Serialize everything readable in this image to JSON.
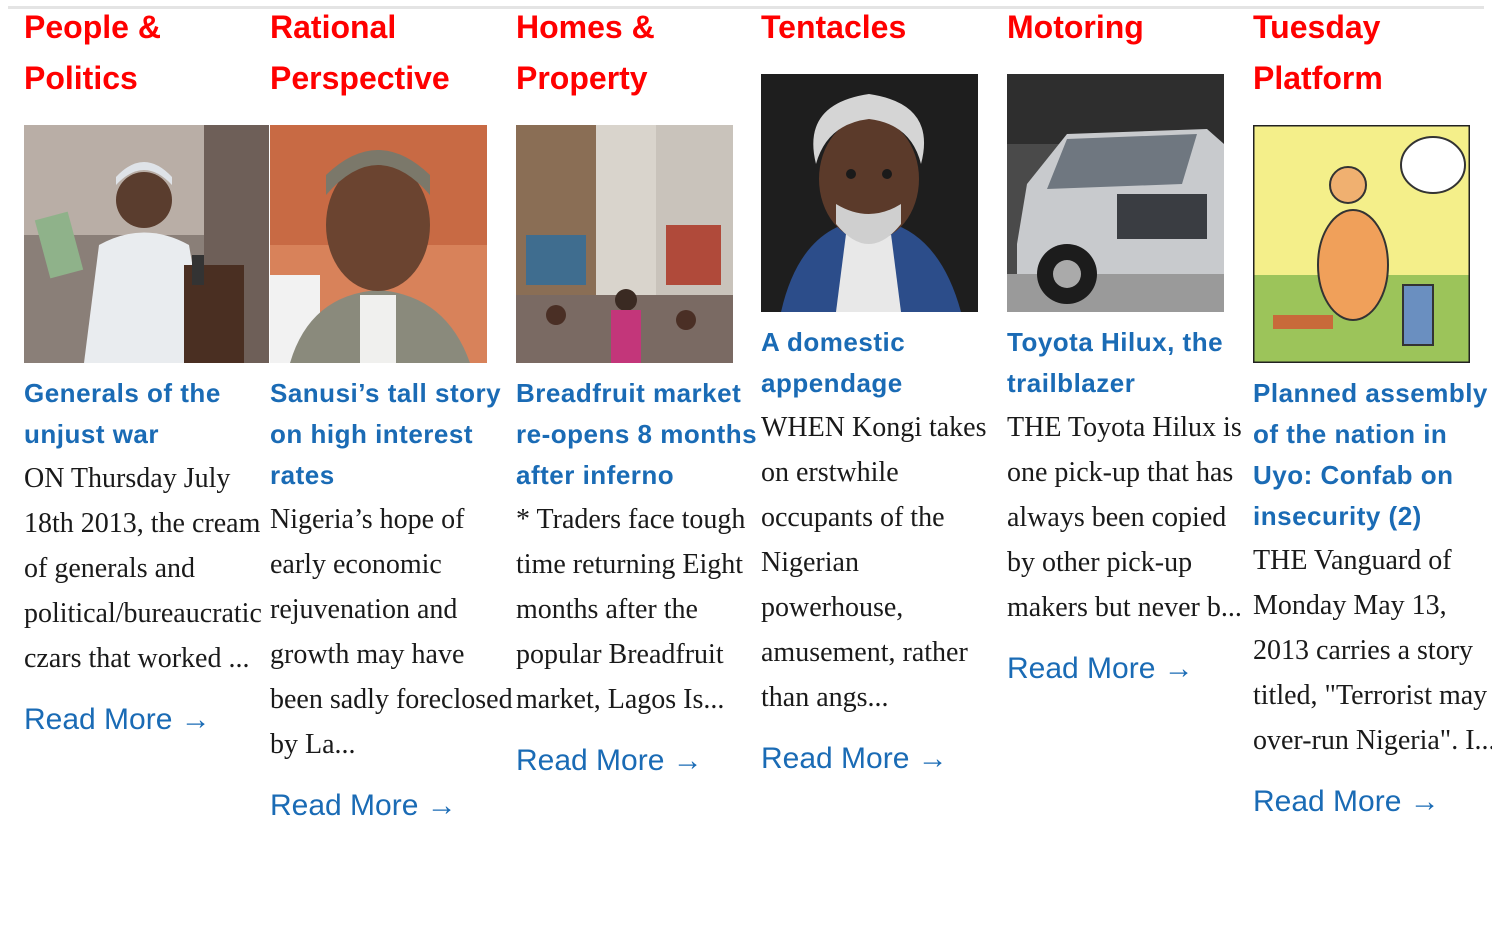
{
  "colors": {
    "category": "#ff0000",
    "link": "#1a6bb5",
    "text": "#1a1a1a"
  },
  "columns": [
    {
      "category": "People & Politics",
      "image_subject": "man-with-money-at-podium",
      "title": "Generals of the unjust war",
      "excerpt": "ON Thursday July 18th 2013, the cream of generals and political/bureaucratic czars that worked ...",
      "read_more": "Read More →"
    },
    {
      "category": "Rational Perspective",
      "image_subject": "man-in-grey-cap-portrait",
      "title": "Sanusi’s tall story on high interest rates",
      "excerpt": "Nigeria’s hope of early economic rejuvenation and growth may have been sadly foreclosed by La...",
      "read_more": "Read More →"
    },
    {
      "category": "Homes & Property",
      "image_subject": "crowded-market-street",
      "title": "Breadfruit market re-opens 8 months after inferno",
      "excerpt": "* Traders face tough time returning Eight months after the popular Breadfruit market, Lagos Is...",
      "read_more": "Read More →"
    },
    {
      "category": "Tentacles",
      "image_subject": "grey-haired-man-portrait",
      "title": "A domestic appendage",
      "excerpt": "WHEN Kongi takes on erstwhile occupants of the Nigerian powerhouse, amusement, rather than angs...",
      "read_more": "Read More →"
    },
    {
      "category": "Motoring",
      "image_subject": "silver-suv",
      "title": "Toyota Hilux, the trailblazer",
      "excerpt": "THE Toyota Hilux is one pick-up that has always been copied by other pick-up makers but never b...",
      "read_more": "Read More →"
    },
    {
      "category": "Tuesday Platform",
      "image_subject": "editorial-cartoon",
      "title": "Planned assembly of the nation in Uyo: Confab on insecurity (2)",
      "excerpt": "THE Vanguard of Monday May 13, 2013 carries a story titled, \"Terrorist may over-run Nigeria\". I...",
      "read_more": "Read More →"
    }
  ]
}
